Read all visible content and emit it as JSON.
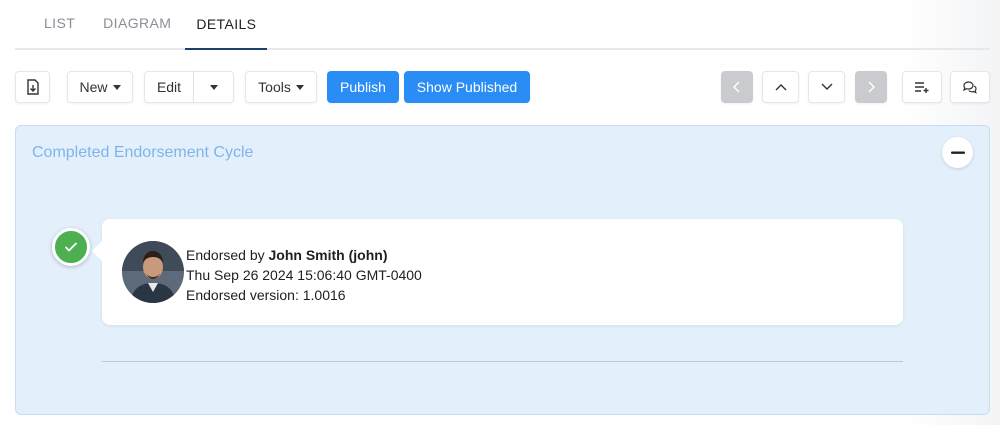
{
  "tabs": [
    {
      "label": "LIST",
      "active": false
    },
    {
      "label": "DIAGRAM",
      "active": false
    },
    {
      "label": "DETAILS",
      "active": true
    }
  ],
  "toolbar": {
    "new_label": "New",
    "edit_label": "Edit",
    "tools_label": "Tools",
    "publish_label": "Publish",
    "show_published_label": "Show Published"
  },
  "panel": {
    "title": "Completed Endorsement Cycle",
    "entry": {
      "prefix": "Endorsed by ",
      "user": "John Smith (john)",
      "timestamp": "Thu Sep 26 2024 15:06:40 GMT-0400",
      "version": "Endorsed version: 1.0016"
    }
  },
  "colors": {
    "primary": "#2a8cf5",
    "panel_bg": "#e3f0fc",
    "panel_title": "#7fb4ea",
    "success": "#4caf50",
    "active_tab_underline": "#1f3e6e"
  },
  "icons": [
    "export-file-icon",
    "chevron-left-icon",
    "chevron-up-icon",
    "chevron-down-icon",
    "chevron-right-icon",
    "add-list-icon",
    "comments-icon",
    "minus-icon",
    "check-icon"
  ]
}
